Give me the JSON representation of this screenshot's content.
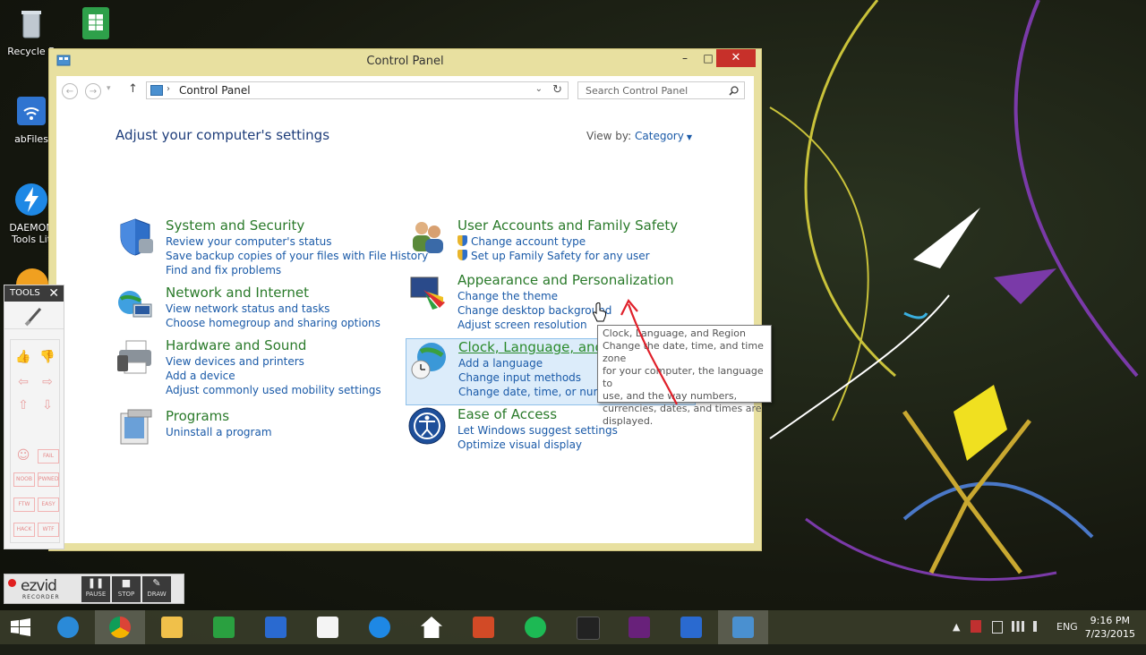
{
  "desktop": {
    "icons": [
      {
        "label": "Recycle B",
        "icon": "recycle-bin-icon"
      },
      {
        "label": "",
        "icon": "spreadsheet-shortcut-icon"
      },
      {
        "label": "abFiles",
        "icon": "wifi-files-icon"
      },
      {
        "label": "DAEMON Tools Lit",
        "icon": "daemon-tools-icon"
      }
    ]
  },
  "window": {
    "title": "Control Panel",
    "buttons": {
      "minimize": "–",
      "maximize": "□",
      "close": "✕"
    },
    "nav": {
      "back": "←",
      "forward": "→",
      "recent": "▾",
      "up": "↑"
    },
    "address": {
      "separator": "›",
      "path": "Control Panel",
      "dropdown": "⌄",
      "refresh": "↻"
    },
    "search": {
      "placeholder": "Search Control Panel",
      "icon": "search-icon"
    },
    "heading": "Adjust your computer's settings",
    "view_by_label": "View by:",
    "view_by_value": "Category",
    "view_by_caret": "▼"
  },
  "categories": [
    {
      "title": "System and Security",
      "icon": "shield-icon",
      "links": [
        "Review your computer's status",
        "Save backup copies of your files with File History",
        "Find and fix problems"
      ]
    },
    {
      "title": "Network and Internet",
      "icon": "network-globe-icon",
      "links": [
        "View network status and tasks",
        "Choose homegroup and sharing options"
      ]
    },
    {
      "title": "Hardware and Sound",
      "icon": "printer-icon",
      "links": [
        "View devices and printers",
        "Add a device",
        "Adjust commonly used mobility settings"
      ]
    },
    {
      "title": "Programs",
      "icon": "programs-icon",
      "links": [
        "Uninstall a program"
      ]
    },
    {
      "title": "User Accounts and Family Safety",
      "icon": "users-icon",
      "links": [
        "Change account type",
        "Set up Family Safety for any user"
      ]
    },
    {
      "title": "Appearance and Personalization",
      "icon": "monitor-palette-icon",
      "links": [
        "Change the theme",
        "Change desktop background",
        "Adjust screen resolution"
      ]
    },
    {
      "title": "Clock, Language, and Region",
      "icon": "clock-globe-icon",
      "links": [
        "Add a language",
        "Change input methods",
        "Change date, time, or number f"
      ]
    },
    {
      "title": "Ease of Access",
      "icon": "ease-of-access-icon",
      "links": [
        "Let Windows suggest settings",
        "Optimize visual display"
      ]
    }
  ],
  "tooltip": {
    "lines": [
      "Clock, Language, and Region",
      "Change the date, time, and time zone",
      "for your computer, the language to",
      "use, and the way numbers,",
      "currencies, dates, and times are",
      "displayed."
    ]
  },
  "tools_panel": {
    "title": "TOOLS",
    "close": "✕",
    "stamps": [
      "👍",
      "👎",
      "⇦",
      "⇨",
      "⇧",
      "⇩",
      "☺",
      "FAIL",
      "NOOB",
      "PWNED",
      "FTW",
      "EASY",
      "HACK",
      "WTF"
    ]
  },
  "ezvid": {
    "logo": "ezvid",
    "sub": "RECORDER",
    "buttons": [
      {
        "label": "PAUSE",
        "glyph": "❚❚"
      },
      {
        "label": "STOP",
        "glyph": "■"
      },
      {
        "label": "DRAW",
        "glyph": "✎"
      }
    ]
  },
  "taskbar": {
    "apps": [
      "start-icon",
      "internet-explorer-icon",
      "chrome-icon",
      "file-explorer-icon",
      "store-icon",
      "daemon-tools-icon",
      "document-icon",
      "daemon-lite-icon",
      "home-icon",
      "powerpoint-icon",
      "spotify-icon",
      "amazon-icon",
      "visual-studio-icon",
      "daemon-icon",
      "control-panel-icon"
    ],
    "tray": {
      "chevron": "▲",
      "language": "ENG",
      "time": "9:16 PM",
      "date": "7/23/2015"
    }
  },
  "colors": {
    "window_frame": "#e8e0a0",
    "link": "#1a5aa8",
    "category_title": "#2a7a2a",
    "highlight_bg": "#dcecfa",
    "close_red": "#c7302a",
    "heading": "#1e3d7a"
  }
}
